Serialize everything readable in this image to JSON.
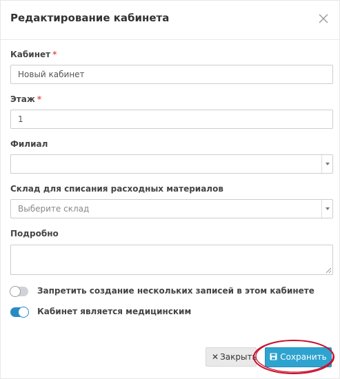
{
  "modal": {
    "title": "Редактирование кабинета",
    "close_icon": "close-icon"
  },
  "fields": {
    "cabinet": {
      "label": "Кабинет",
      "required_mark": "*",
      "value": "Новый кабинет"
    },
    "floor": {
      "label": "Этаж",
      "required_mark": "*",
      "value": "1"
    },
    "branch": {
      "label": "Филиал",
      "value": ""
    },
    "warehouse": {
      "label": "Склад для списания расходных материалов",
      "placeholder": "Выберите склад"
    },
    "details": {
      "label": "Подробно",
      "value": ""
    }
  },
  "toggles": [
    {
      "label": "Запретить создание нескольких записей в этом кабинете",
      "state": "off"
    },
    {
      "label": "Кабинет является медицинским",
      "state": "on"
    }
  ],
  "footer": {
    "close_label": "Закрыть",
    "save_label": "Сохранить"
  },
  "colors": {
    "primary": "#2fa3cf",
    "toggle_on": "#2a8bc4",
    "annotation": "#c8102e",
    "required": "#e05a4f"
  }
}
